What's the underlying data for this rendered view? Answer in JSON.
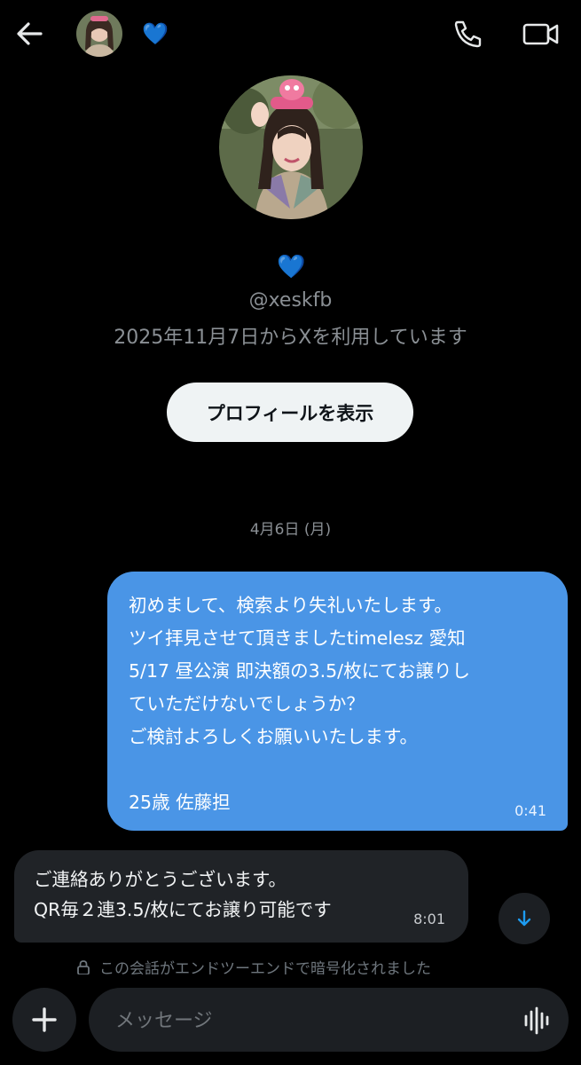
{
  "header": {
    "back_icon": "arrow-left-icon",
    "contact_emoji": "💙",
    "call_icon": "phone-icon",
    "video_icon": "video-camera-icon"
  },
  "profile": {
    "emoji": "💙",
    "handle": "@xeskfb",
    "joined": "2025年11月7日からXを利用しています",
    "view_profile_label": "プロフィールを表示"
  },
  "conversation": {
    "date_divider": "4月6日 (月)",
    "messages": [
      {
        "direction": "outgoing",
        "lines": [
          "初めまして、検索より失礼いたします。",
          "ツイ拝見させて頂きましたtimelesz 愛知",
          "5/17 昼公演 即決額の3.5/枚にてお譲りし",
          "ていただけないでしょうか？",
          "ご検討よろしくお願いいたします。",
          "",
          "25歳 佐藤担"
        ],
        "time": "0:41"
      },
      {
        "direction": "incoming",
        "lines": [
          "ご連絡ありがとうございます。",
          "QR毎２連3.5/枚にてお譲り可能です"
        ],
        "time": "8:01"
      }
    ],
    "encryption_notice": "この会話がエンドツーエンドで暗号化されました"
  },
  "composer": {
    "placeholder": "メッセージ",
    "add_icon": "plus-icon",
    "voice_icon": "voice-waveform-icon"
  },
  "colors": {
    "background": "#000000",
    "outgoing_bubble": "#4a95e6",
    "incoming_bubble": "#202327",
    "accent": "#1d9bf0"
  }
}
